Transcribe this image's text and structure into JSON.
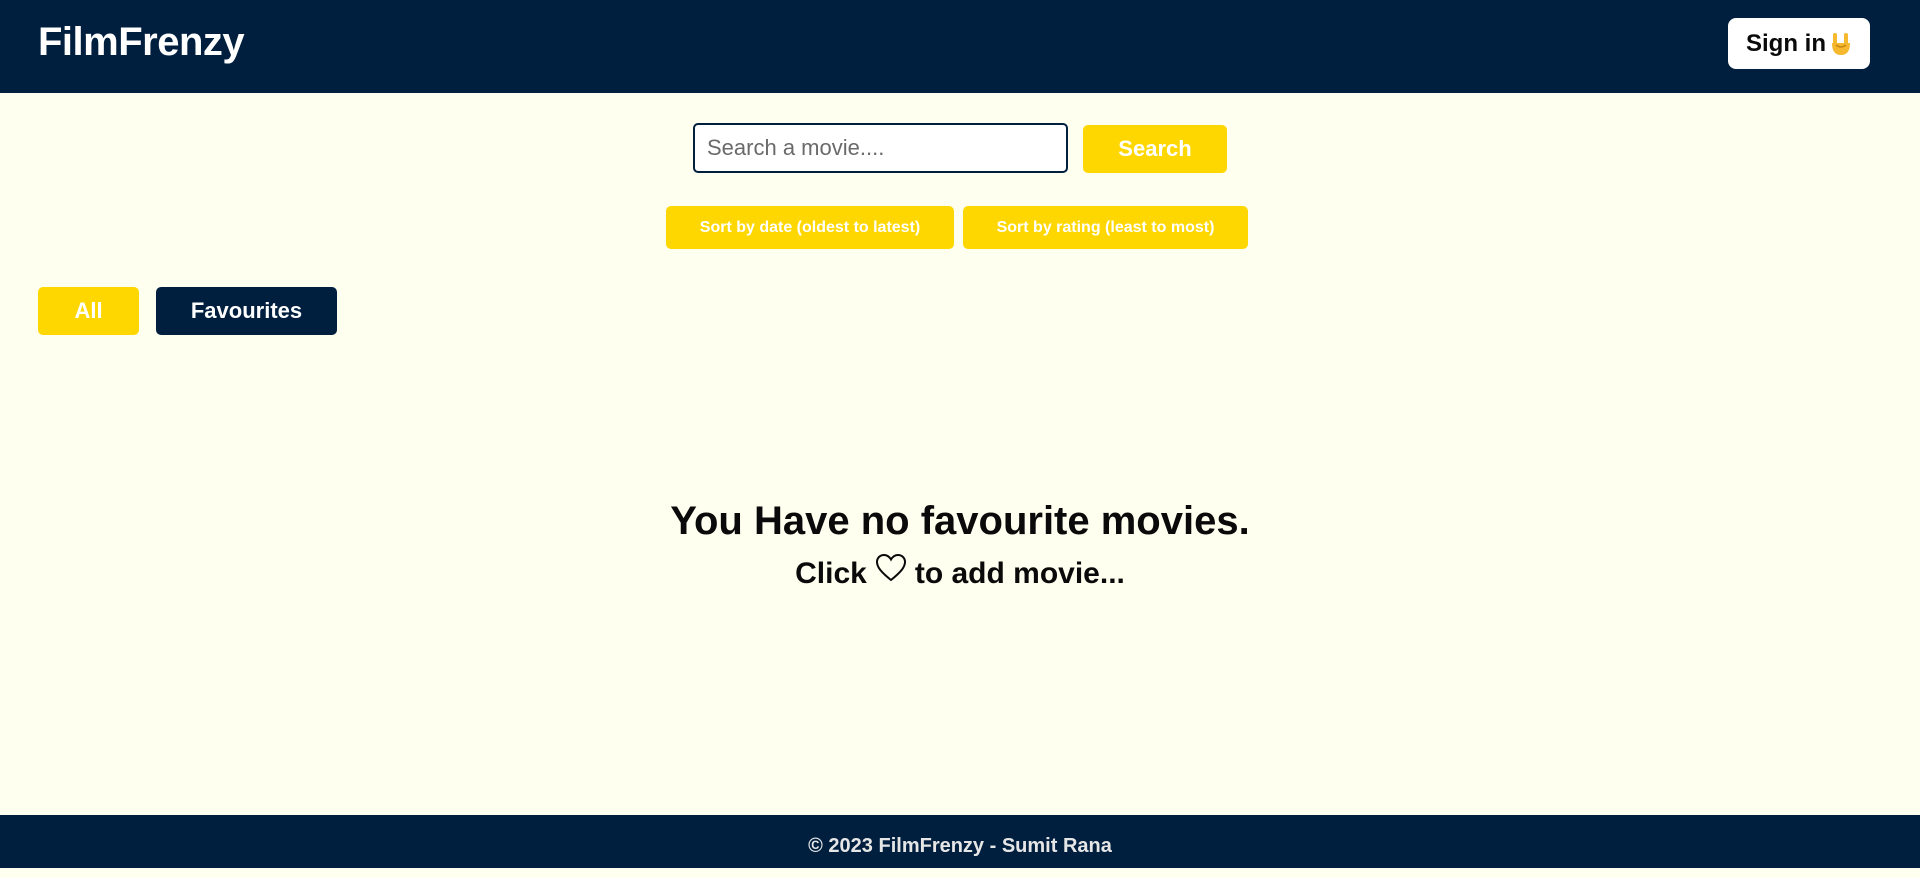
{
  "navbar": {
    "brand": "FilmFrenzy",
    "signin_label": "Sign in",
    "signin_icon": "rock-on-hand-icon"
  },
  "search": {
    "placeholder": "Search a movie....",
    "value": "",
    "button_label": "Search"
  },
  "sort": {
    "by_date_label": "Sort by date (oldest to latest)",
    "by_rating_label": "Sort by rating (least to most)"
  },
  "tabs": [
    {
      "label": "All",
      "color": "#ffd700"
    },
    {
      "label": "Favourites",
      "color": "#001f3f"
    }
  ],
  "empty_state": {
    "title": "You Have no favourite movies.",
    "sub_prefix": "Click",
    "sub_icon": "heart-outline-icon",
    "sub_suffix": "to add movie..."
  },
  "footer": {
    "text": "© 2023 FilmFrenzy - Sumit Rana"
  },
  "colors": {
    "navy": "#001f3f",
    "accent": "#ffd700",
    "background": "#fffff0"
  }
}
